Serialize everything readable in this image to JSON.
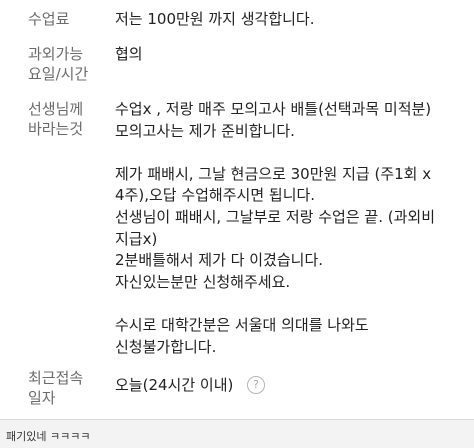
{
  "rows": {
    "fee": {
      "label": "수업료",
      "value": "저는 100만원 까지 생각합니다."
    },
    "days": {
      "label": "과외가능\n요일/시간",
      "value": "협의"
    },
    "notes": {
      "label": "선생님께\n바라는것",
      "value": "수업x , 저랑 매주 모의고사 배틀(선택과목 미적분)\n모의고사는 제가 준비합니다.\n\n제가 패배시, 그날 현금으로 30만원 지급 (주1회 x\n4주),오답 수업해주시면 됩니다.\n선생님이 패배시, 그날부로 저랑 수업은 끝. (과외비\n지급x)\n2분배틀해서 제가 다 이겼습니다.\n자신있는분만 신청해주세요.\n\n수시로 대학간분은 서울대 의대를 나와도\n신청불가합니다."
    },
    "last_access": {
      "label": "최근접속\n일자",
      "value": "오늘(24시간 이내)",
      "help_icon": "question-circle-icon"
    }
  },
  "footer": {
    "text": "패기있네 ㅋㅋㅋㅋ"
  }
}
